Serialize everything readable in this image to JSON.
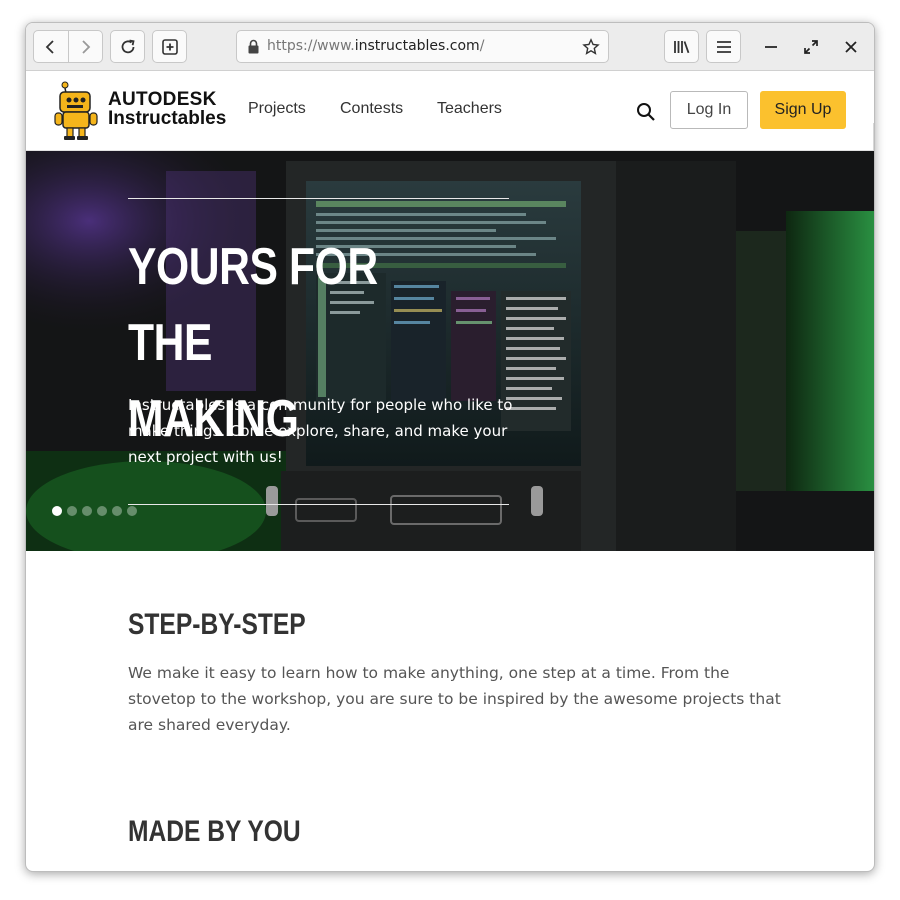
{
  "browser": {
    "url_prefix": "https://www.",
    "url_host": "instructables.com",
    "url_suffix": "/"
  },
  "site": {
    "logo_line1": "AUTODESK",
    "logo_line2": "Instructables",
    "nav": [
      "Projects",
      "Contests",
      "Teachers"
    ],
    "login_label": "Log In",
    "signup_label": "Sign Up",
    "accent_color": "#fbc12e"
  },
  "hero": {
    "title_line1": "YOURS FOR THE",
    "title_line2": "MAKING",
    "subtitle": "Instructables is a community for people who like to make things. Come explore, share, and make your next project with us!",
    "slide_count": 6,
    "active_slide": 1
  },
  "sections": [
    {
      "title": "STEP-BY-STEP",
      "body": "We make it easy to learn how to make anything, one step at a time. From the stovetop to the workshop, you are sure to be inspired by the awesome projects that are shared everyday."
    },
    {
      "title": "MADE BY YOU"
    }
  ]
}
